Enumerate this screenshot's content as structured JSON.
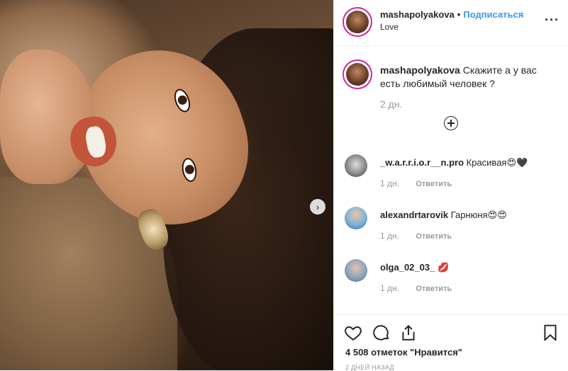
{
  "header": {
    "username": "mashapolyakova",
    "dot": "•",
    "follow_label": "Подписаться",
    "subtitle": "Love",
    "more_icon": "more-horizontal-icon"
  },
  "caption": {
    "username": "mashapolyakova",
    "text": "Скажите а у вас есть любимый человек ?",
    "time": "2 дн."
  },
  "load_more_icon": "plus-circle-icon",
  "comments": [
    {
      "username": "_w.a.r.r.i.o.r__n.pro",
      "text": "Красивая😍🖤",
      "time": "1 дн.",
      "reply": "Ответить"
    },
    {
      "username": "alexandrtarovik",
      "text": "Гарнюня😍😍",
      "time": "1 дн.",
      "reply": "Ответить"
    },
    {
      "username": "olga_02_03_",
      "text": "💋",
      "time": "1 дн.",
      "reply": "Ответить"
    }
  ],
  "actions": {
    "like_icon": "heart-icon",
    "comment_icon": "comment-icon",
    "share_icon": "share-icon",
    "save_icon": "bookmark-icon",
    "likes": "4 508 отметок \"Нравится\"",
    "posted": "2 дней назад"
  },
  "carousel_next_icon": "chevron-right-icon"
}
